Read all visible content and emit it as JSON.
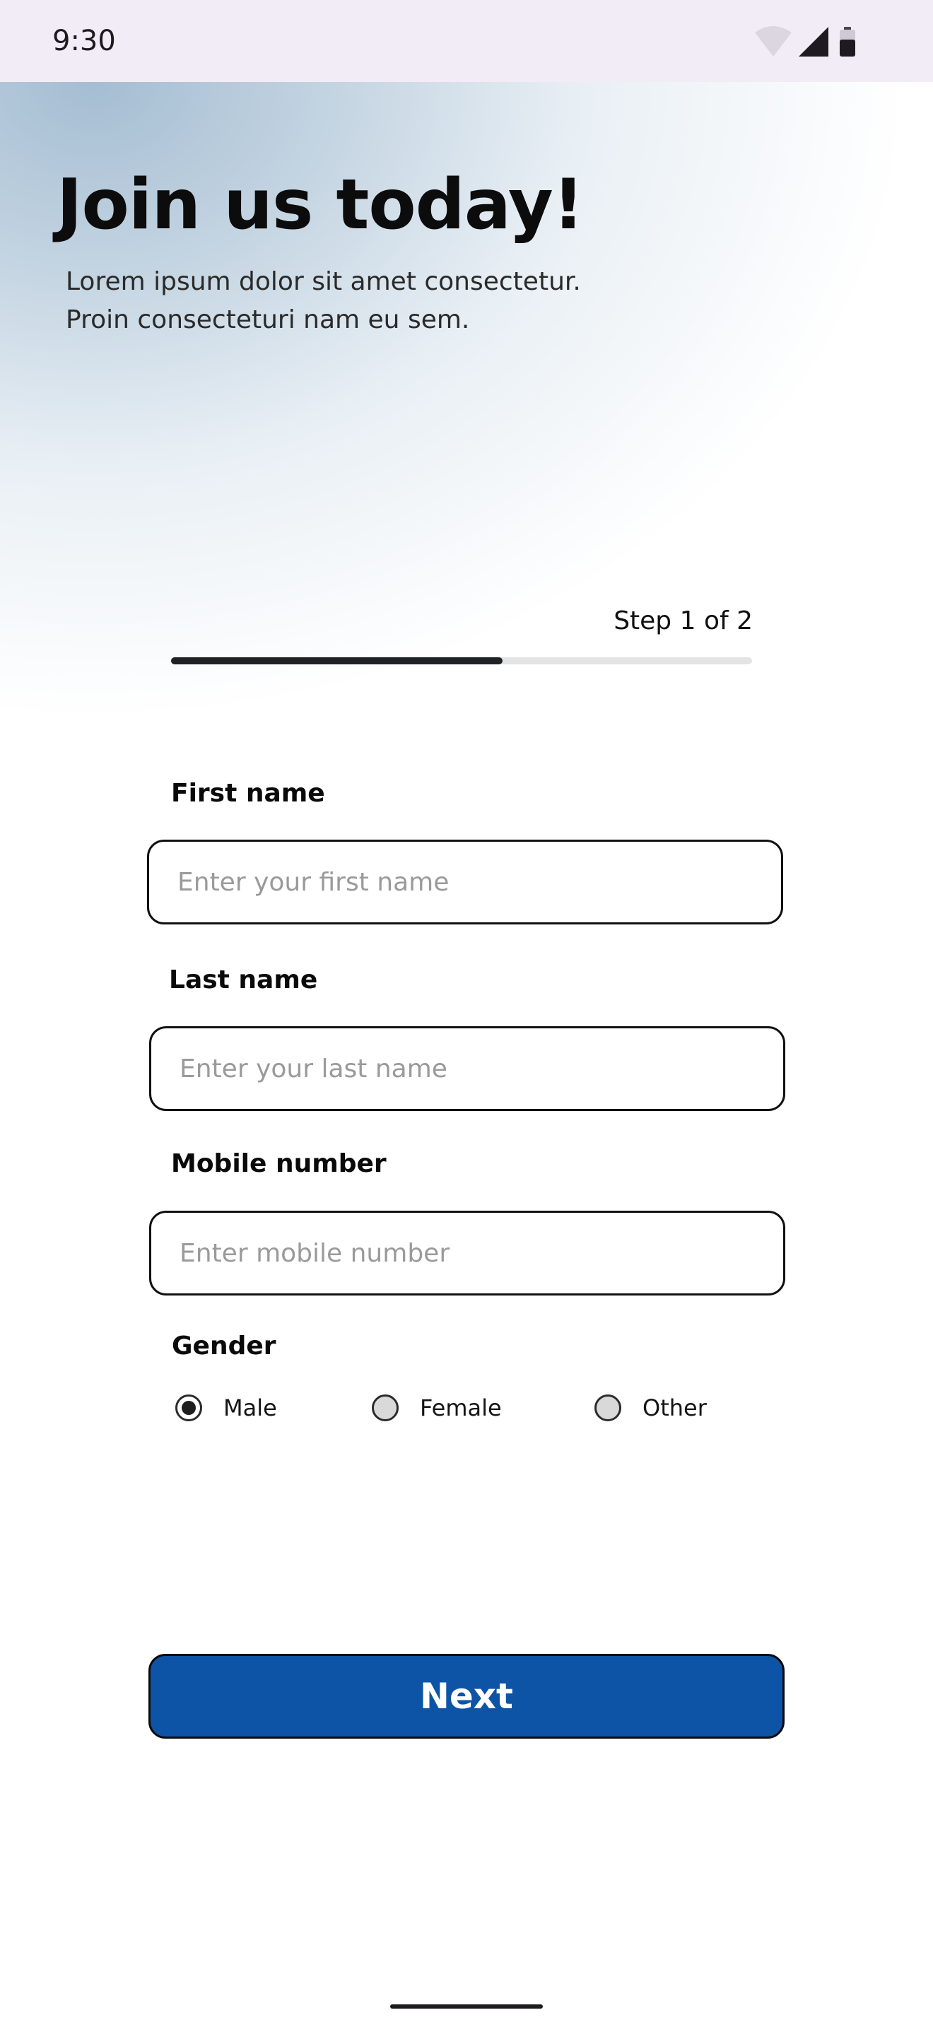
{
  "status_bar": {
    "time": "9:30",
    "icons": [
      "wifi-icon",
      "signal-icon",
      "battery-icon"
    ]
  },
  "header": {
    "title": "Join us today!",
    "subtitle_line1": "Lorem ipsum dolor sit amet consectetur.",
    "subtitle_line2": "Proin consecteturi nam eu sem."
  },
  "progress": {
    "label": "Step 1 of 2",
    "current_step": 1,
    "total_steps": 2,
    "fraction_complete": 0.57
  },
  "form": {
    "first_name": {
      "label": "First name",
      "value": "",
      "placeholder": "Enter your first name"
    },
    "last_name": {
      "label": "Last name",
      "value": "",
      "placeholder": "Enter your last name"
    },
    "mobile": {
      "label": "Mobile number",
      "value": "",
      "placeholder": "Enter mobile number"
    },
    "gender": {
      "label": "Gender",
      "selected": "Male",
      "options": [
        "Male",
        "Female",
        "Other"
      ]
    }
  },
  "actions": {
    "next_label": "Next"
  },
  "colors": {
    "primary_button": "#0e54a6",
    "progress_fill": "#1e2226",
    "progress_track": "#e4e4e4",
    "status_bar_bg": "#f2ecf6"
  }
}
